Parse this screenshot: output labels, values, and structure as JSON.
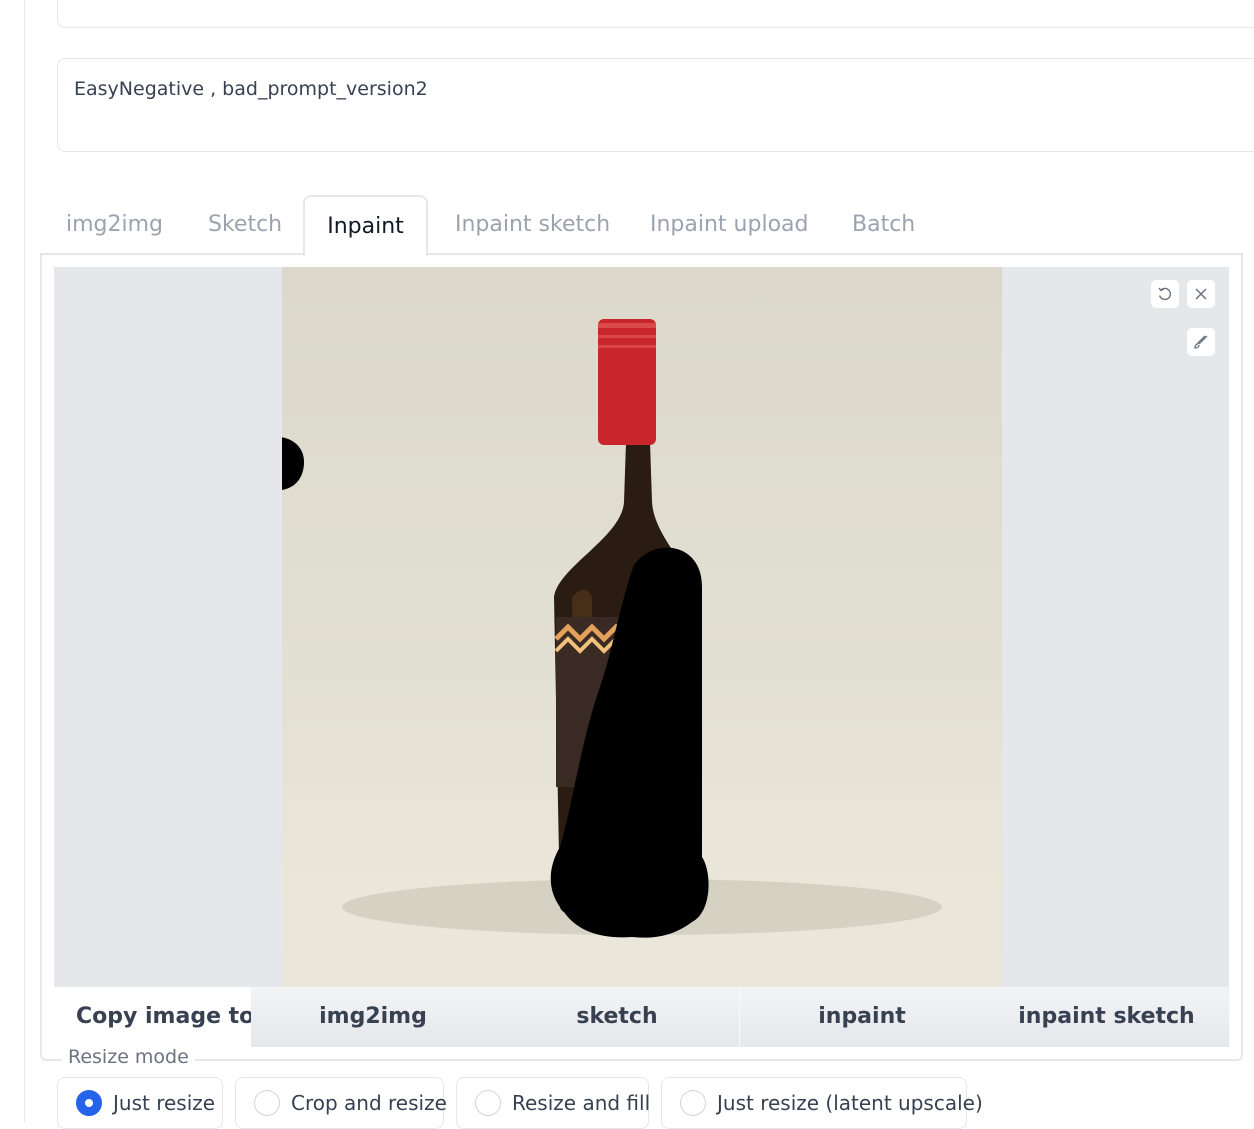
{
  "negative_prompt": {
    "value": "EasyNegative , bad_prompt_version2"
  },
  "tabs": [
    {
      "label": "img2img"
    },
    {
      "label": "Sketch"
    },
    {
      "label": "Inpaint",
      "selected": true
    },
    {
      "label": "Inpaint sketch"
    },
    {
      "label": "Inpaint upload"
    },
    {
      "label": "Batch"
    }
  ],
  "canvas_tools": {
    "icons": [
      "undo-icon",
      "close-icon",
      "brush-icon"
    ]
  },
  "copy": {
    "label": "Copy image to:",
    "buttons": [
      "img2img",
      "sketch",
      "inpaint",
      "inpaint sketch"
    ]
  },
  "resize_mode": {
    "legend": "Resize mode",
    "options": [
      "Just resize",
      "Crop and resize",
      "Resize and fill",
      "Just resize (latent upscale)"
    ],
    "selected": "Just resize"
  },
  "colors": {
    "accent": "#2563eb",
    "mask": "#000000",
    "cap": "#c8262a"
  }
}
